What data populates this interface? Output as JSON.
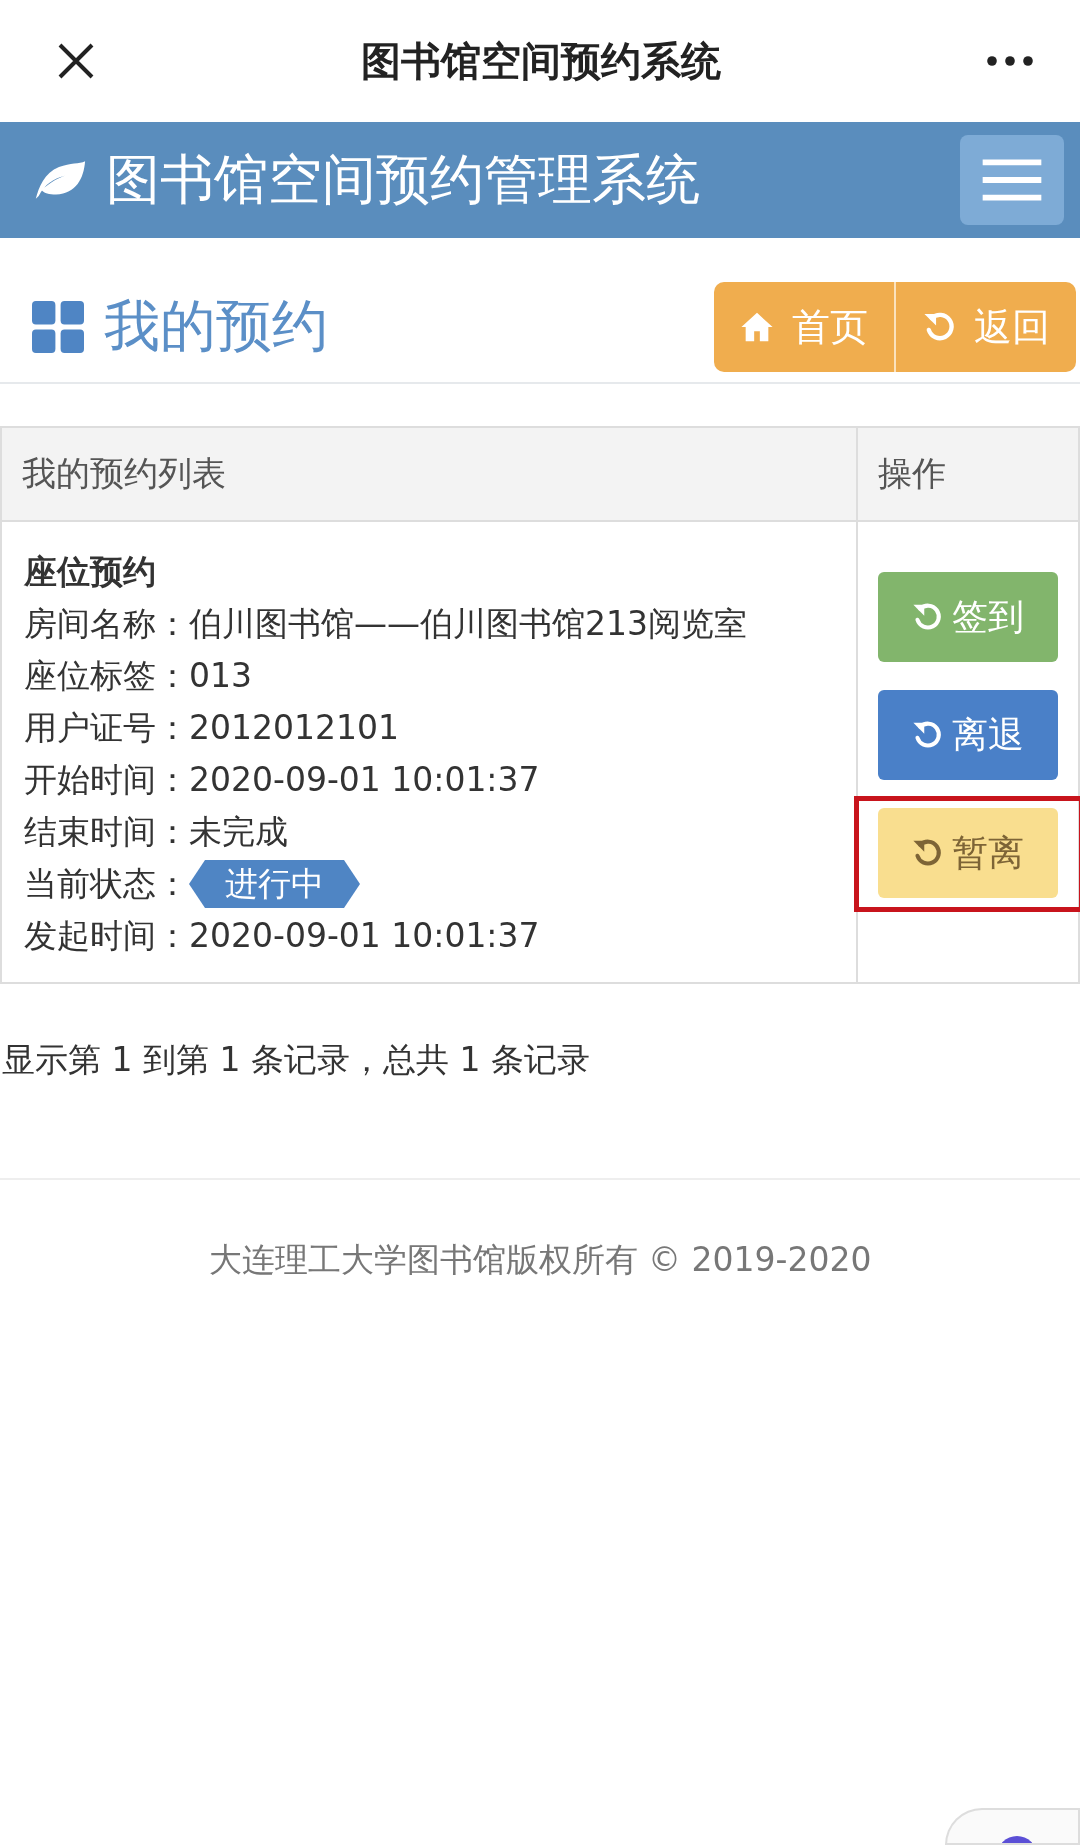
{
  "window": {
    "title": "图书馆空间预约系统"
  },
  "navbar": {
    "brand": "图书馆空间预约管理系统"
  },
  "page": {
    "heading": "我的预约",
    "buttons": [
      {
        "label": "首页",
        "kind": "home"
      },
      {
        "label": "返回",
        "kind": "back"
      }
    ]
  },
  "table": {
    "columns": [
      "我的预约列表",
      "操作"
    ],
    "rows": [
      {
        "title": "座位预约",
        "fields": [
          {
            "label": "房间名称：",
            "value": "伯川图书馆——伯川图书馆213阅览室",
            "kind": "text"
          },
          {
            "label": "座位标签：",
            "value": "013",
            "kind": "text"
          },
          {
            "label": "用户证号：",
            "value": "2012012101",
            "kind": "text"
          },
          {
            "label": "开始时间：",
            "value": "2020-09-01 10:01:37",
            "kind": "text"
          },
          {
            "label": "结束时间：",
            "value": "未完成",
            "kind": "text"
          },
          {
            "label": "当前状态：",
            "value": "进行中",
            "kind": "badge"
          },
          {
            "label": "发起时间：",
            "value": "2020-09-01 10:01:37",
            "kind": "text"
          }
        ],
        "actions": [
          {
            "label": "签到",
            "kind": "success",
            "highlighted": false
          },
          {
            "label": "离退",
            "kind": "primary",
            "highlighted": false
          },
          {
            "label": "暂离",
            "kind": "warning",
            "highlighted": true
          }
        ]
      }
    ]
  },
  "pagination": {
    "text": "显示第 1 到第 1 条记录，总共 1 条记录"
  },
  "footer": {
    "text": "大连理工大学图书馆版权所有 © 2019-2020"
  }
}
